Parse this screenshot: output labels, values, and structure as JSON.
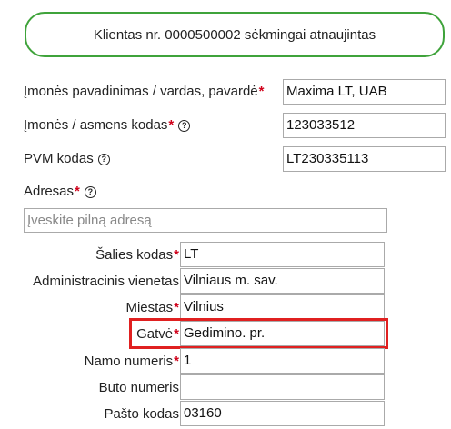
{
  "banner": {
    "text": "Klientas nr. 0000500002 sėkmingai atnaujintas"
  },
  "form": {
    "company_name": {
      "label": "Įmonės pavadinimas / vardas, pavardė",
      "value": "Maxima LT, UAB"
    },
    "company_code": {
      "label": "Įmonės / asmens kodas",
      "value": "123033512"
    },
    "vat_code": {
      "label": "PVM kodas",
      "value": "LT230335113"
    },
    "address": {
      "label": "Adresas",
      "placeholder": "Įveskite pilną adresą"
    },
    "country_code": {
      "label": "Šalies kodas",
      "value": "LT"
    },
    "admin_unit": {
      "label": "Administracinis vienetas",
      "value": "Vilniaus m. sav."
    },
    "city": {
      "label": "Miestas",
      "value": "Vilnius"
    },
    "street": {
      "label": "Gatvė",
      "value": "Gedimino. pr."
    },
    "house_number": {
      "label": "Namo numeris",
      "value": "1"
    },
    "apartment": {
      "label": "Buto numeris",
      "value": ""
    },
    "postal_code": {
      "label": "Pašto kodas",
      "value": "03160"
    }
  },
  "required_mark": "*",
  "help_glyph": "?",
  "colors": {
    "success_border": "#3fa33b",
    "required": "#d0021b",
    "highlight": "#e02020"
  }
}
